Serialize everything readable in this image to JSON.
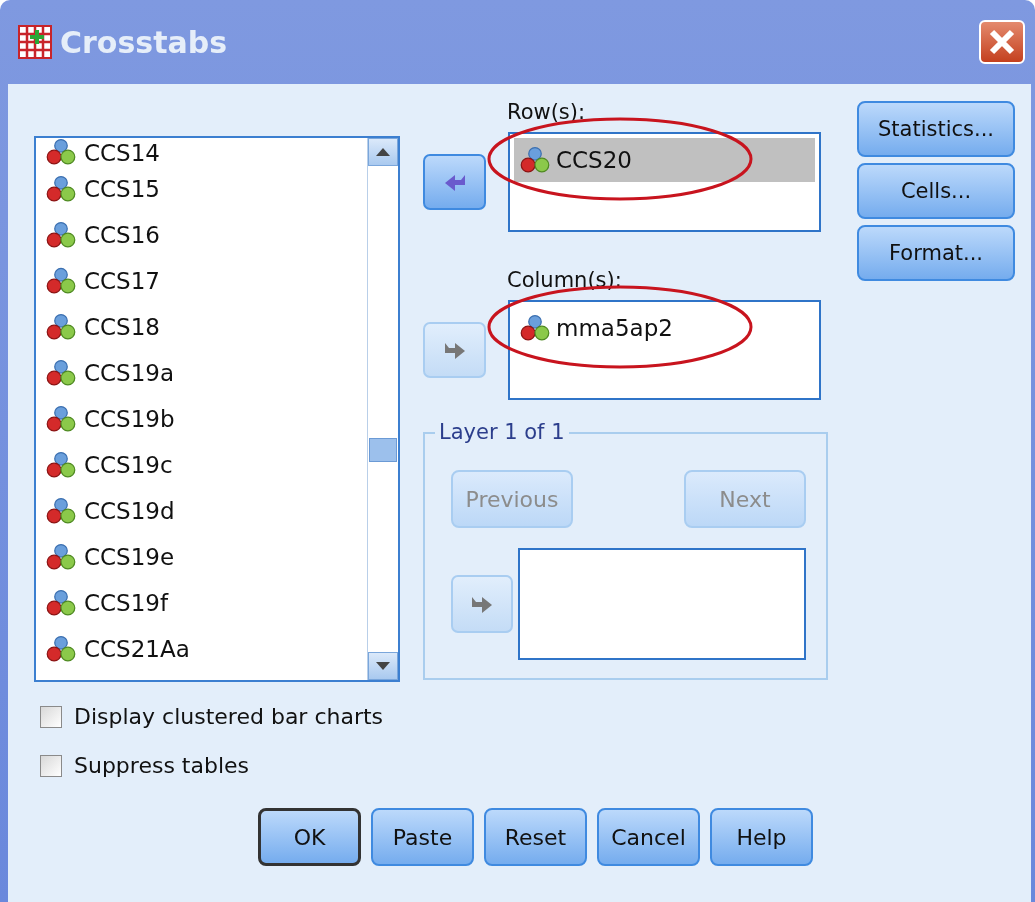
{
  "window": {
    "title": "Crosstabs"
  },
  "variables": [
    {
      "name": "CCS14"
    },
    {
      "name": "CCS15"
    },
    {
      "name": "CCS16"
    },
    {
      "name": "CCS17"
    },
    {
      "name": "CCS18"
    },
    {
      "name": "CCS19a"
    },
    {
      "name": "CCS19b"
    },
    {
      "name": "CCS19c"
    },
    {
      "name": "CCS19d"
    },
    {
      "name": "CCS19e"
    },
    {
      "name": "CCS19f"
    },
    {
      "name": "CCS21Aa"
    }
  ],
  "rows": {
    "label": "Row(s):",
    "arrow": {
      "kind": "left",
      "disabled": false
    },
    "items": [
      {
        "name": "CCS20",
        "selected": true,
        "circled": true
      }
    ]
  },
  "columns": {
    "label": "Column(s):",
    "arrow": {
      "kind": "right",
      "disabled": true
    },
    "items": [
      {
        "name": "mma5ap2",
        "selected": false,
        "circled": true
      }
    ]
  },
  "layer": {
    "title": "Layer 1 of 1",
    "previous": {
      "label": "Previous",
      "disabled": true
    },
    "next": {
      "label": "Next",
      "disabled": true
    },
    "arrow": {
      "kind": "right",
      "disabled": true
    }
  },
  "side_buttons": [
    {
      "label": "Statistics..."
    },
    {
      "label": "Cells..."
    },
    {
      "label": "Format..."
    }
  ],
  "options": [
    {
      "label": "Display clustered bar charts",
      "checked": false
    },
    {
      "label": "Suppress tables",
      "checked": false
    }
  ],
  "buttons": [
    {
      "label": "OK",
      "default": true
    },
    {
      "label": "Paste",
      "default": false
    },
    {
      "label": "Reset",
      "default": false
    },
    {
      "label": "Cancel",
      "default": false
    },
    {
      "label": "Help",
      "default": false
    }
  ]
}
